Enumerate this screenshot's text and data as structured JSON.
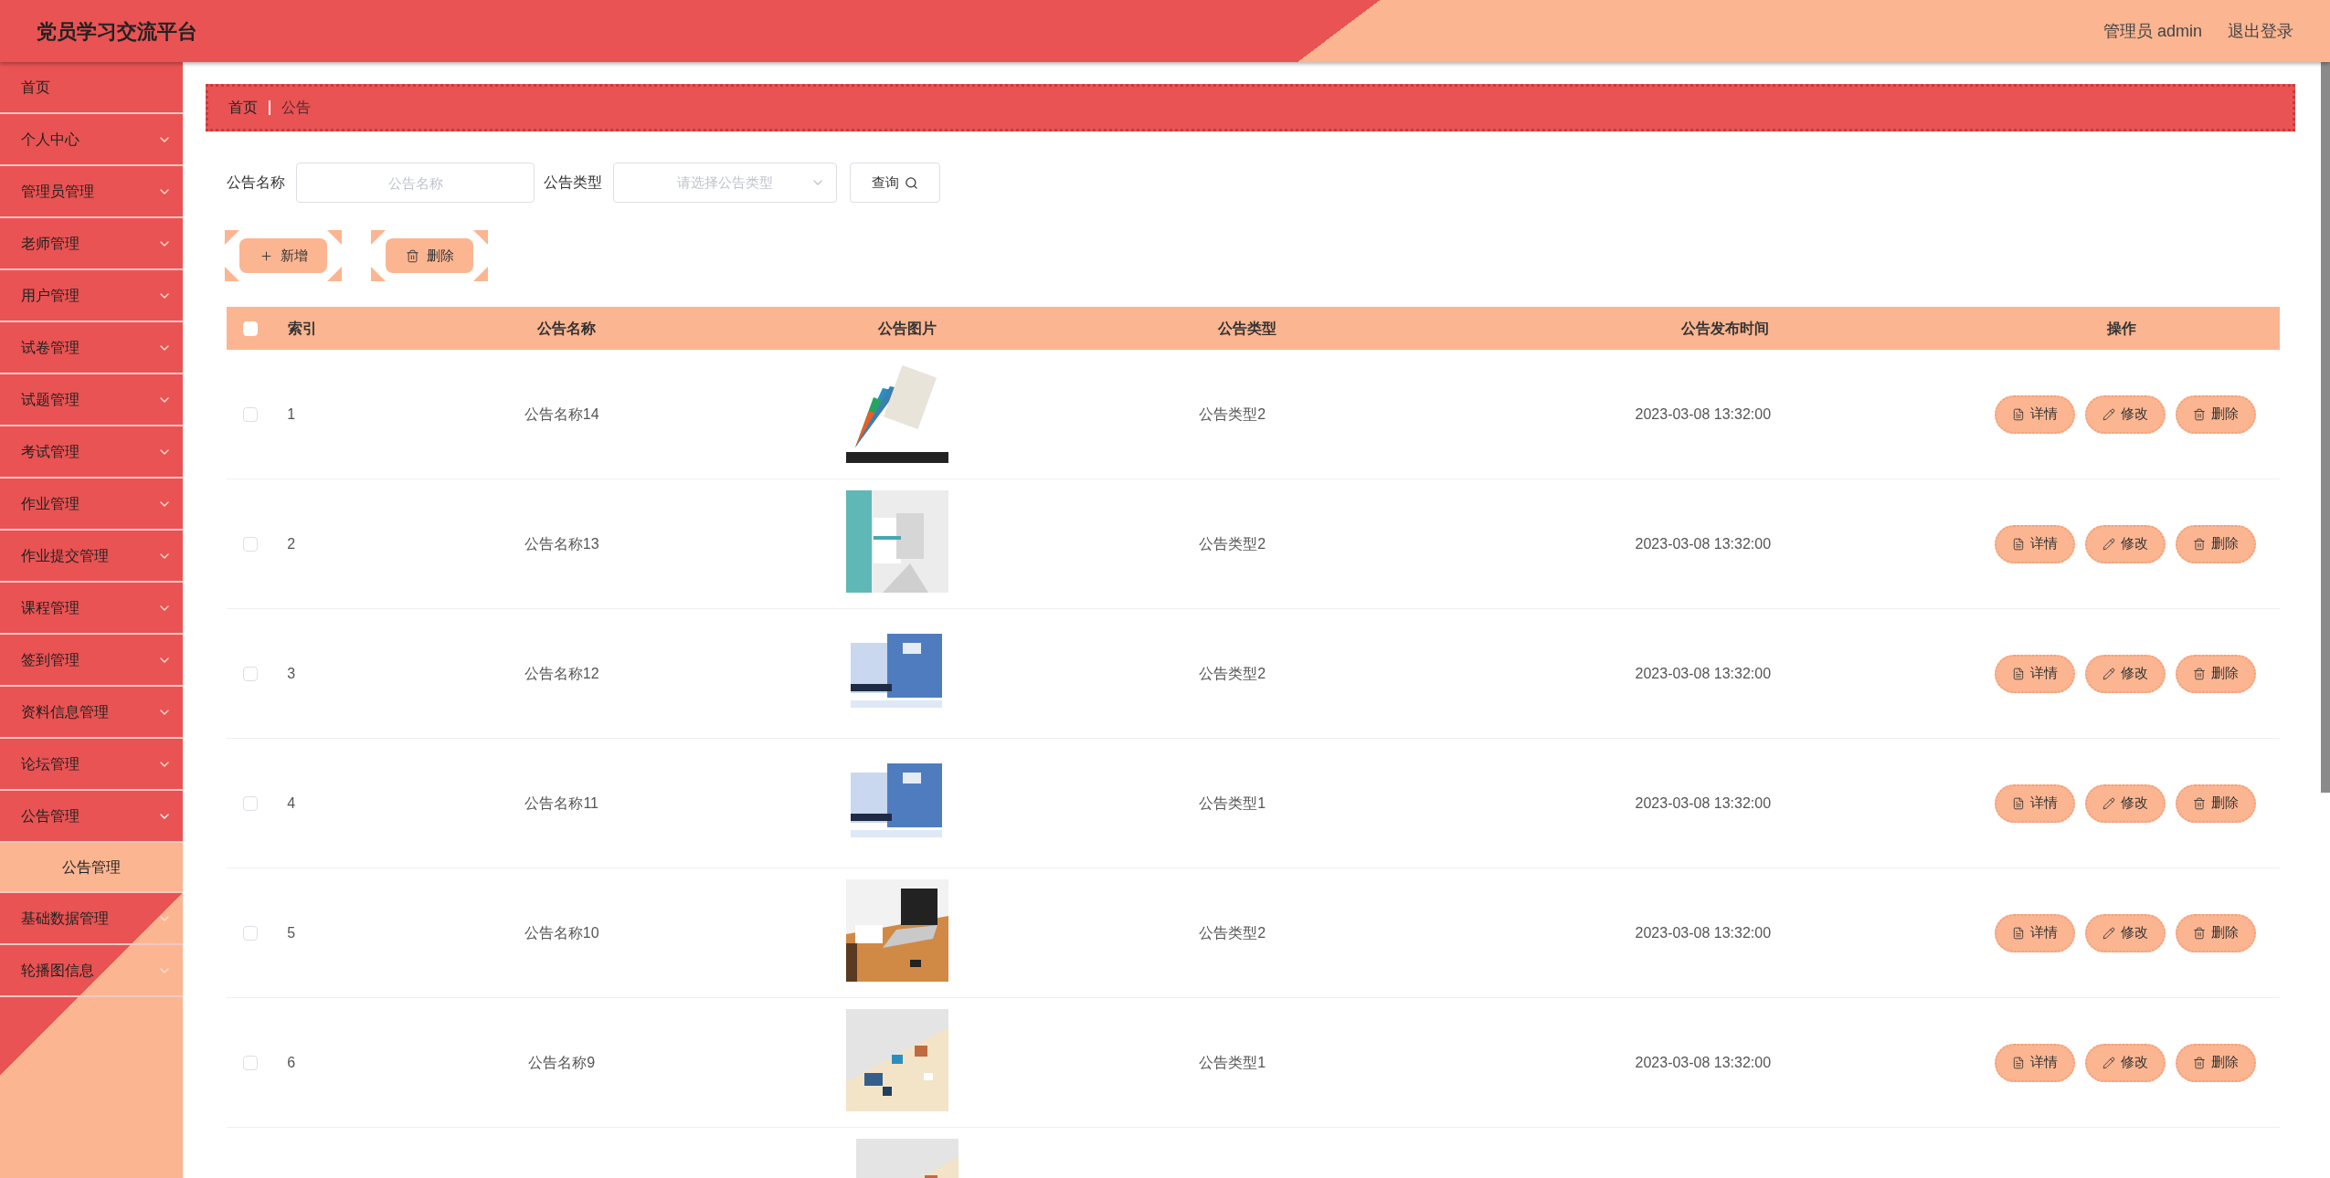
{
  "header": {
    "title": "党员学习交流平台",
    "user": "管理员 admin",
    "logout": "退出登录"
  },
  "sidebar": {
    "items": [
      {
        "label": "首页",
        "expandable": false
      },
      {
        "label": "个人中心",
        "expandable": true
      },
      {
        "label": "管理员管理",
        "expandable": true
      },
      {
        "label": "老师管理",
        "expandable": true
      },
      {
        "label": "用户管理",
        "expandable": true
      },
      {
        "label": "试卷管理",
        "expandable": true
      },
      {
        "label": "试题管理",
        "expandable": true
      },
      {
        "label": "考试管理",
        "expandable": true
      },
      {
        "label": "作业管理",
        "expandable": true
      },
      {
        "label": "作业提交管理",
        "expandable": true
      },
      {
        "label": "课程管理",
        "expandable": true
      },
      {
        "label": "签到管理",
        "expandable": true
      },
      {
        "label": "资料信息管理",
        "expandable": true
      },
      {
        "label": "论坛管理",
        "expandable": true
      },
      {
        "label": "公告管理",
        "expandable": true,
        "expanded": true,
        "children": [
          {
            "label": "公告管理",
            "selected": true
          }
        ]
      },
      {
        "label": "基础数据管理",
        "expandable": true
      },
      {
        "label": "轮播图信息",
        "expandable": true
      }
    ]
  },
  "breadcrumb": [
    "首页",
    "公告"
  ],
  "search": {
    "fields": [
      {
        "kind": "input",
        "label": "公告名称",
        "placeholder": "公告名称"
      },
      {
        "kind": "select",
        "label": "公告类型",
        "placeholder": "请选择公告类型"
      }
    ],
    "button": "查询"
  },
  "toolbar": [
    {
      "kind": "add",
      "label": "新增"
    },
    {
      "kind": "delete",
      "label": "删除"
    }
  ],
  "table": {
    "select_all": {
      "checked": false
    },
    "columns": [
      "索引",
      "公告名称",
      "公告图片",
      "公告类型",
      "公告发布时间",
      "操作"
    ],
    "rows": [
      {
        "checked": false,
        "index": "1",
        "name": "公告名称14",
        "image": {
          "kind": "picture"
        },
        "type": "公告类型2",
        "time": "2023-03-08 13:32:00",
        "actions": [
          {
            "kind": "detail",
            "label": "详情"
          },
          {
            "kind": "edit",
            "label": "修改"
          },
          {
            "kind": "delete",
            "label": "删除"
          }
        ]
      },
      {
        "checked": false,
        "index": "2",
        "name": "公告名称13",
        "image": {
          "kind": "picture"
        },
        "type": "公告类型2",
        "time": "2023-03-08 13:32:00",
        "actions": [
          {
            "kind": "detail",
            "label": "详情"
          },
          {
            "kind": "edit",
            "label": "修改"
          },
          {
            "kind": "delete",
            "label": "删除"
          }
        ]
      },
      {
        "checked": false,
        "index": "3",
        "name": "公告名称12",
        "image": {
          "kind": "picture"
        },
        "type": "公告类型2",
        "time": "2023-03-08 13:32:00",
        "actions": [
          {
            "kind": "detail",
            "label": "详情"
          },
          {
            "kind": "edit",
            "label": "修改"
          },
          {
            "kind": "delete",
            "label": "删除"
          }
        ]
      },
      {
        "checked": false,
        "index": "4",
        "name": "公告名称11",
        "image": {
          "kind": "picture"
        },
        "type": "公告类型1",
        "time": "2023-03-08 13:32:00",
        "actions": [
          {
            "kind": "detail",
            "label": "详情"
          },
          {
            "kind": "edit",
            "label": "修改"
          },
          {
            "kind": "delete",
            "label": "删除"
          }
        ]
      },
      {
        "checked": false,
        "index": "5",
        "name": "公告名称10",
        "image": {
          "kind": "picture"
        },
        "type": "公告类型2",
        "time": "2023-03-08 13:32:00",
        "actions": [
          {
            "kind": "detail",
            "label": "详情"
          },
          {
            "kind": "edit",
            "label": "修改"
          },
          {
            "kind": "delete",
            "label": "删除"
          }
        ]
      },
      {
        "checked": false,
        "index": "6",
        "name": "公告名称9",
        "image": {
          "kind": "picture"
        },
        "type": "公告类型1",
        "time": "2023-03-08 13:32:00",
        "actions": [
          {
            "kind": "detail",
            "label": "详情"
          },
          {
            "kind": "edit",
            "label": "修改"
          },
          {
            "kind": "delete",
            "label": "删除"
          }
        ]
      },
      {
        "image": {
          "kind": "picture"
        }
      }
    ]
  }
}
